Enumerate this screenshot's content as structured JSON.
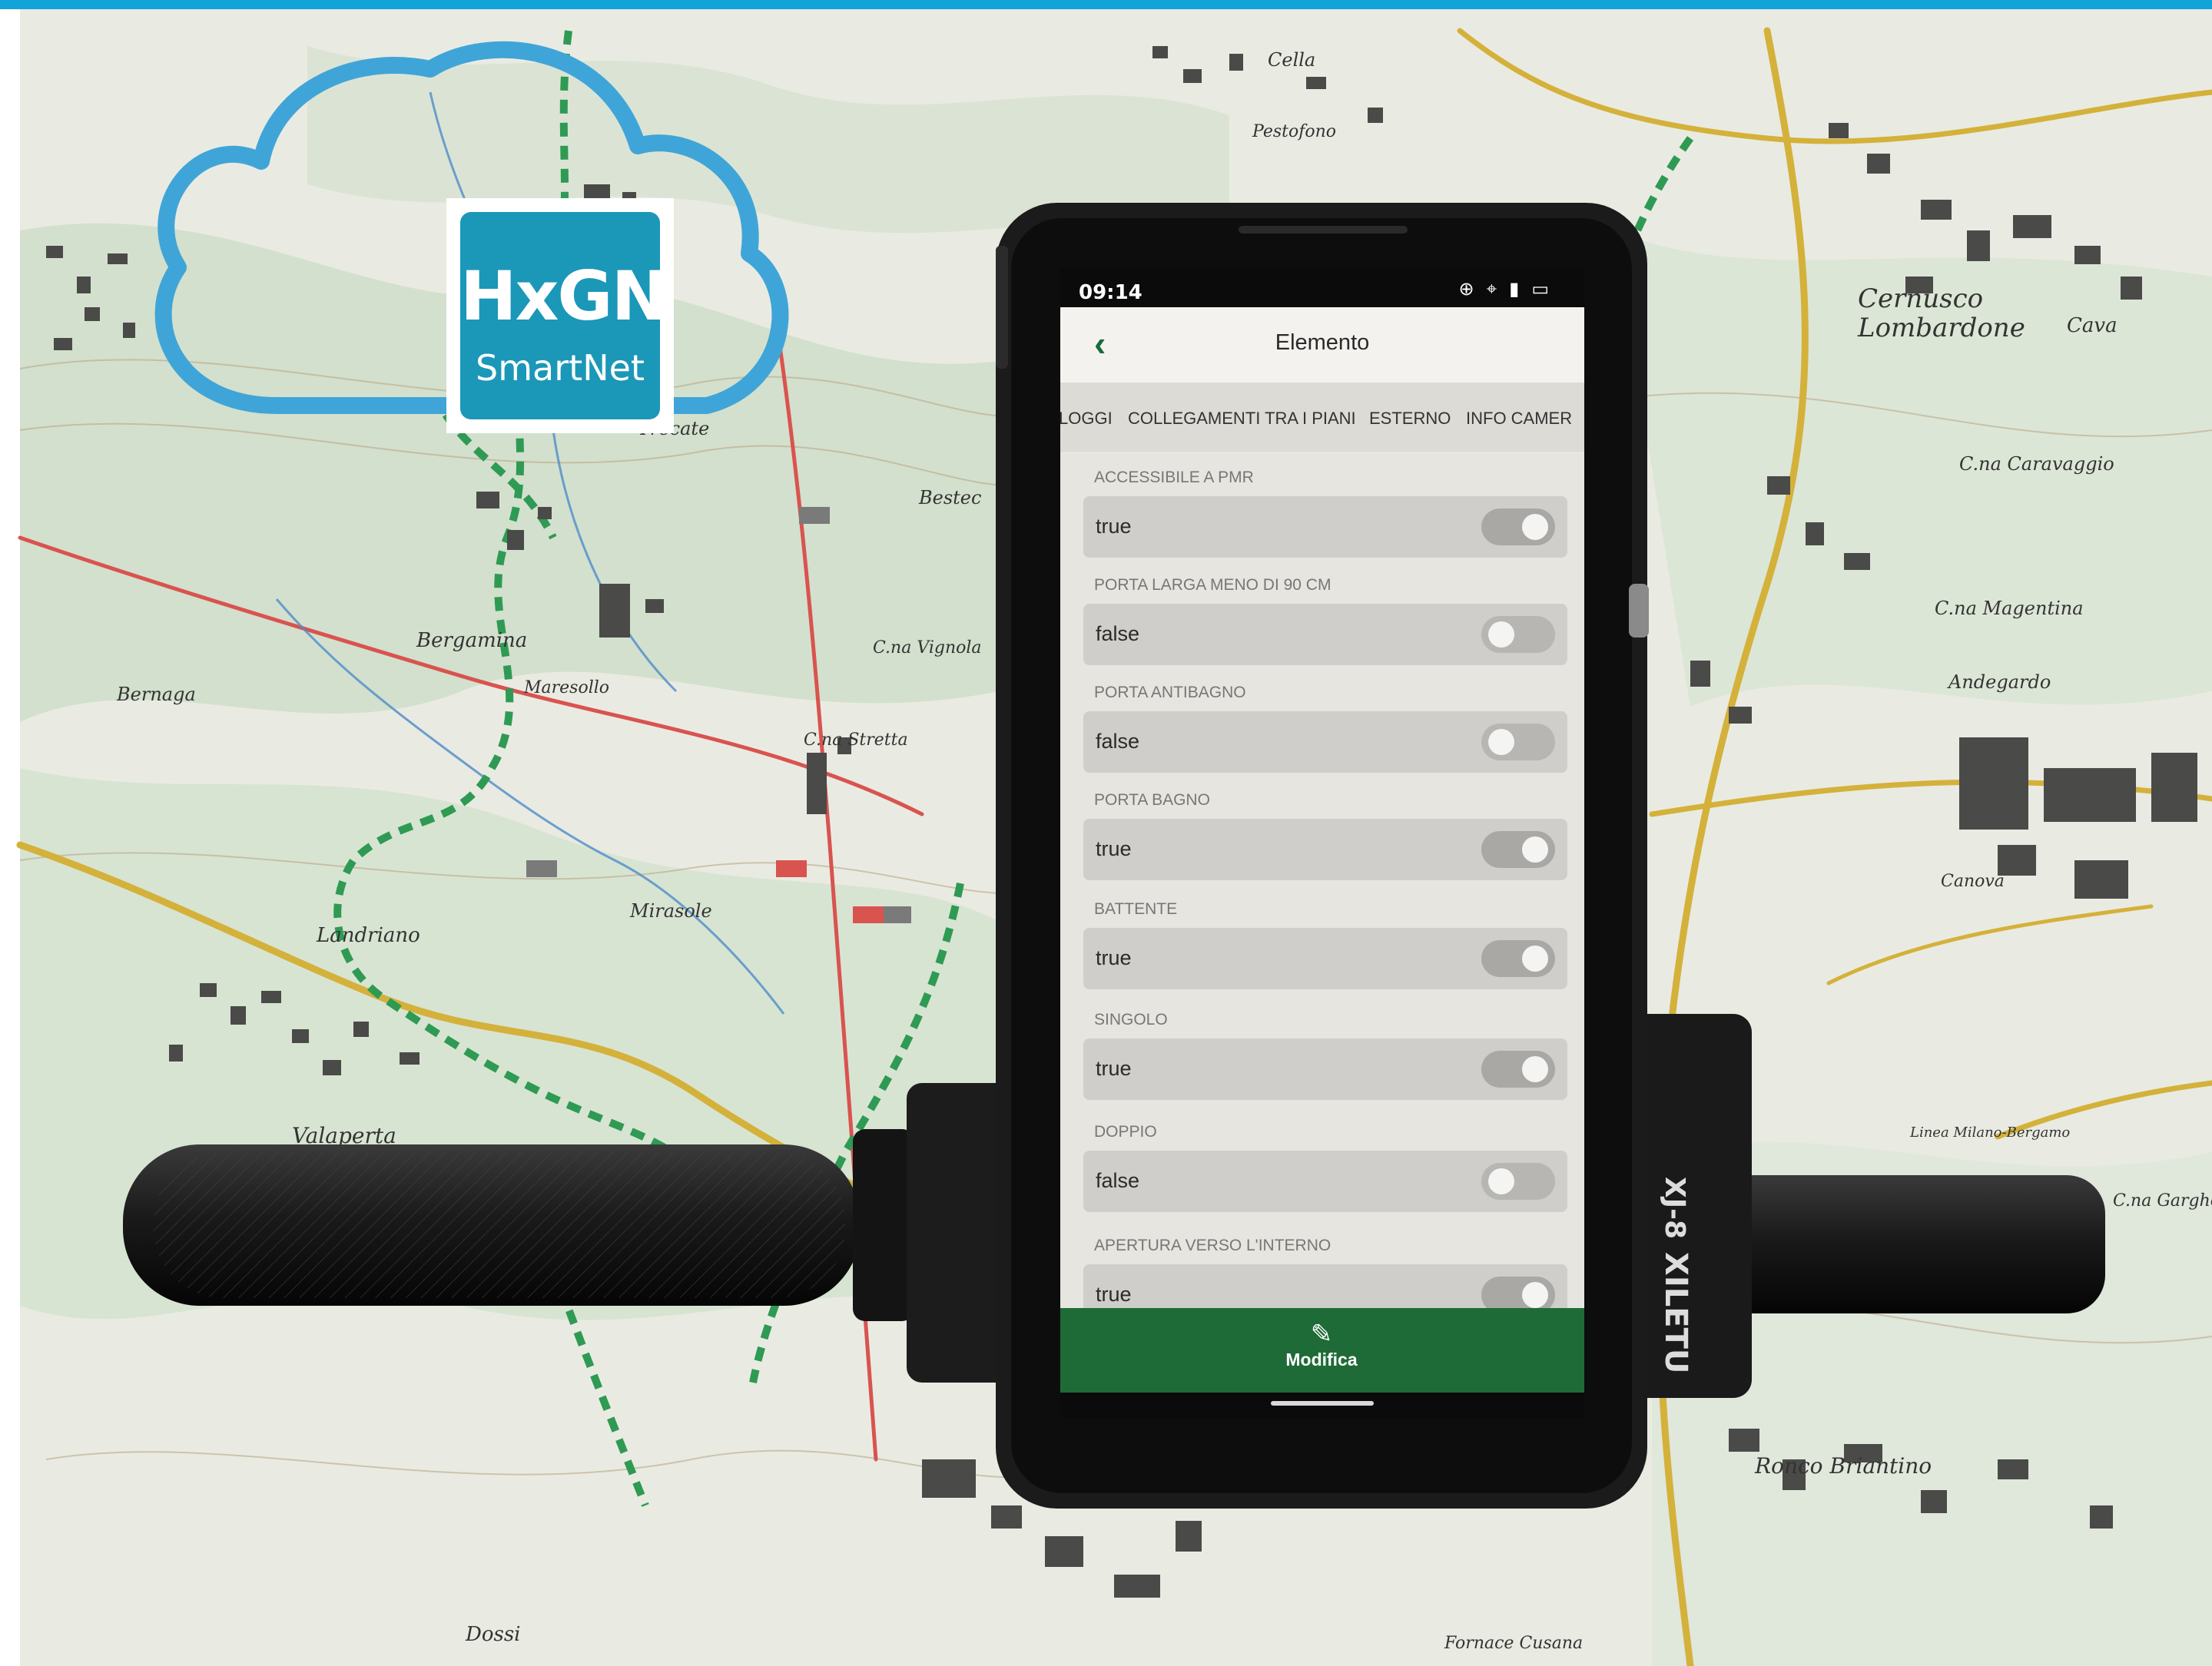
{
  "brand": {
    "logo_primary": "HxGN",
    "logo_secondary": "SmartNet",
    "color": "#1b97b8",
    "cloud_color": "#3fa5d8",
    "top_bar_color": "#12a3d9"
  },
  "device": {
    "brand": "XILETU",
    "model": "XJ-8"
  },
  "map_labels": [
    "Cernusco Lombardone",
    "Cava",
    "C.na Caravaggio",
    "C.na Magentina",
    "Andegardo",
    "Canova",
    "Linea Milano-Bergamo",
    "C.na Garghentino",
    "Ronco Briantino",
    "Bergamina",
    "Maresollo",
    "Bernaga",
    "Landriano",
    "Valaperta",
    "Mirasole",
    "C.na Vignola",
    "C.na Stretta",
    "Bestec",
    "Trecate",
    "Pestofono",
    "Cella",
    "Dossi",
    "Fornace Cusana"
  ],
  "phone": {
    "status": {
      "time": "09:14",
      "icons": [
        "sync-icon",
        "location-icon",
        "sim-icon",
        "battery-icon"
      ]
    },
    "header": {
      "back_icon": "chevron-left-icon",
      "title": "Elemento"
    },
    "tabs": [
      "LOGGI",
      "COLLEGAMENTI TRA I PIANI",
      "ESTERNO",
      "INFO CAMER"
    ],
    "fields": [
      {
        "label": "ACCESSIBILE A PMR",
        "value": "true",
        "on": true
      },
      {
        "label": "PORTA LARGA MENO DI 90 CM",
        "value": "false",
        "on": false
      },
      {
        "label": "PORTA ANTIBAGNO",
        "value": "false",
        "on": false
      },
      {
        "label": "PORTA BAGNO",
        "value": "true",
        "on": true
      },
      {
        "label": "BATTENTE",
        "value": "true",
        "on": true
      },
      {
        "label": "SINGOLO",
        "value": "true",
        "on": true
      },
      {
        "label": "DOPPIO",
        "value": "false",
        "on": false
      },
      {
        "label": "APERTURA VERSO L'INTERNO",
        "value": "true",
        "on": true
      }
    ],
    "action": {
      "icon": "pencil-icon",
      "label": "Modifica"
    },
    "colors": {
      "accent": "#1f6b38",
      "back": "#1a6b3b"
    }
  }
}
